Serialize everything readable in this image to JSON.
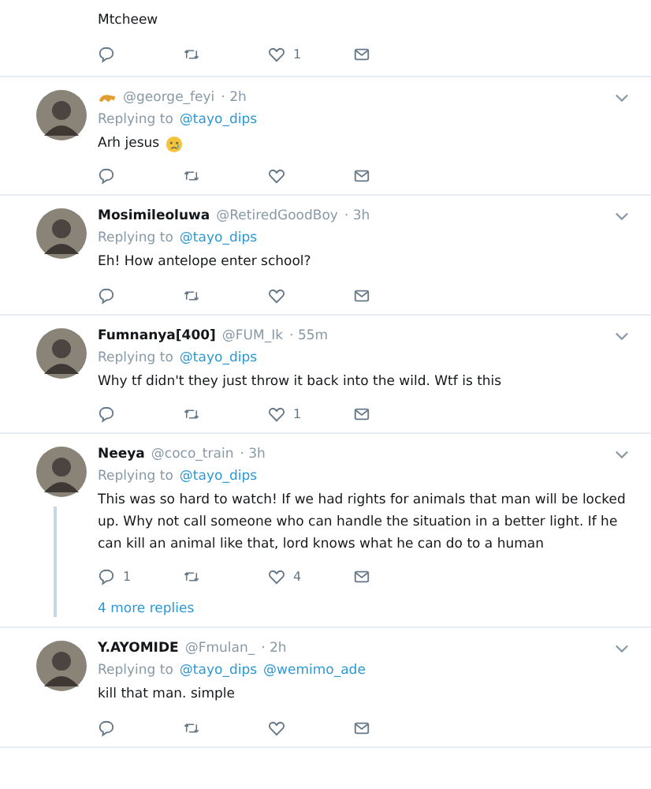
{
  "tweets": [
    {
      "kind": "partial",
      "text": "Mtcheew",
      "like_count": "1"
    },
    {
      "kind": "full",
      "name_emoji": true,
      "handle": "@george_feyi",
      "time": "· 2h",
      "replying_label": "Replying to",
      "replying_to": [
        "@tayo_dips"
      ],
      "text": "Arh jesus",
      "text_emoji": true
    },
    {
      "kind": "full",
      "name": "Mosimileoluwa",
      "handle": "@RetiredGoodBoy",
      "time": "· 3h",
      "replying_label": "Replying to",
      "replying_to": [
        "@tayo_dips"
      ],
      "text": "Eh! How antelope enter school?"
    },
    {
      "kind": "full",
      "name": "Fumnanya[400]",
      "handle": "@FUM_Ik",
      "time": "· 55m",
      "replying_label": "Replying to",
      "replying_to": [
        "@tayo_dips"
      ],
      "text": "Why tf didn't they just throw it back into the wild. Wtf is this",
      "like_count": "1"
    },
    {
      "kind": "full",
      "name": "Neeya",
      "handle": "@coco_train",
      "time": "· 3h",
      "replying_label": "Replying to",
      "replying_to": [
        "@tayo_dips"
      ],
      "text": "This was so hard to watch! If we had rights for animals that man will be locked up. Why not call someone who can handle the situation in a better light. If he can kill an animal like that, lord knows what he can do to a human",
      "reply_count": "1",
      "like_count": "4",
      "more_replies": "4 more replies"
    },
    {
      "kind": "full",
      "name": "Y.AYOMIDE",
      "handle": "@Fmulan_",
      "time": "· 2h",
      "replying_label": "Replying to",
      "replying_to": [
        "@tayo_dips",
        "@wemimo_ade"
      ],
      "text": "kill that man. simple"
    }
  ]
}
